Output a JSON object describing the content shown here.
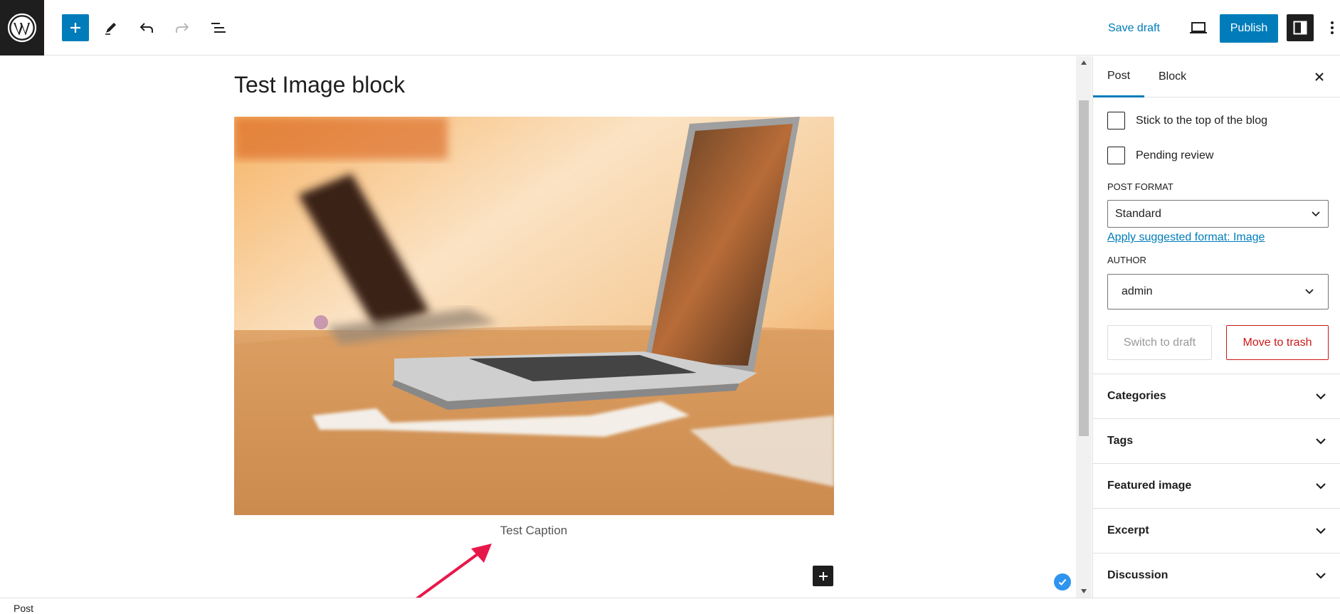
{
  "toolbar": {
    "save_draft_label": "Save draft",
    "publish_label": "Publish"
  },
  "editor": {
    "post_title": "Test Image block",
    "image_caption": "Test Caption"
  },
  "sidebar": {
    "tabs": [
      "Post",
      "Block"
    ],
    "active_tab": "Post",
    "stick_to_top_label": "Stick to the top of the blog",
    "pending_review_label": "Pending review",
    "post_format_label": "POST FORMAT",
    "post_format_value": "Standard",
    "suggest_format_link": "Apply suggested format: Image",
    "author_label": "AUTHOR",
    "author_value": "admin",
    "switch_to_draft_label": "Switch to draft",
    "move_to_trash_label": "Move to trash",
    "panels": [
      "Categories",
      "Tags",
      "Featured image",
      "Excerpt",
      "Discussion"
    ]
  },
  "footer": {
    "breadcrumb": "Post"
  },
  "colors": {
    "accent": "#007cba",
    "danger": "#cc1818",
    "dark": "#1e1e1e",
    "annotation_arrow": "#e8174a"
  }
}
